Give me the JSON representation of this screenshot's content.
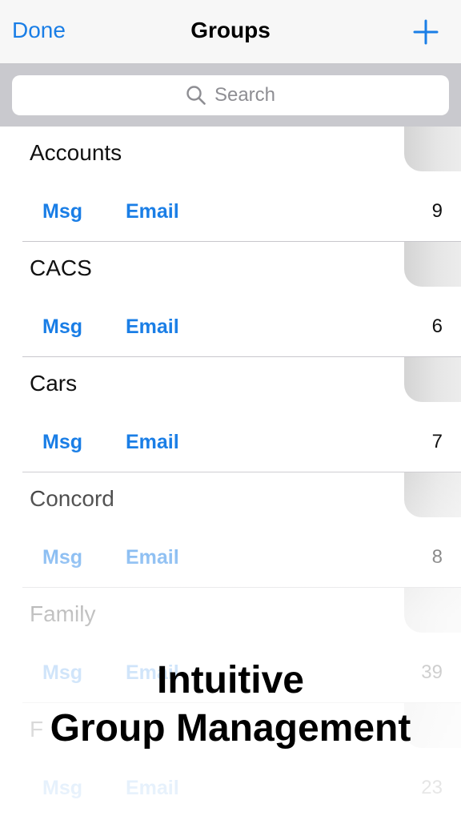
{
  "navbar": {
    "done_label": "Done",
    "title": "Groups",
    "add_icon": "plus-icon"
  },
  "search": {
    "placeholder": "Search",
    "icon": "search-icon"
  },
  "groups": [
    {
      "name": "Accounts",
      "msg": "Msg",
      "email": "Email",
      "count": "9"
    },
    {
      "name": "CACS",
      "msg": "Msg",
      "email": "Email",
      "count": "6"
    },
    {
      "name": "Cars",
      "msg": "Msg",
      "email": "Email",
      "count": "7"
    },
    {
      "name": "Concord",
      "msg": "Msg",
      "email": "Email",
      "count": "8"
    },
    {
      "name": "Family",
      "msg": "Msg",
      "email": "Email",
      "count": "39"
    },
    {
      "name": "F",
      "msg": "Msg",
      "email": "Email",
      "count": "23"
    }
  ],
  "promo": {
    "line1": "Intuitive",
    "line2": "Group Management"
  },
  "colors": {
    "accent": "#1a7ee6",
    "navbar_bg": "#f7f7f7",
    "searchbar_bg": "#c9c9ce"
  }
}
